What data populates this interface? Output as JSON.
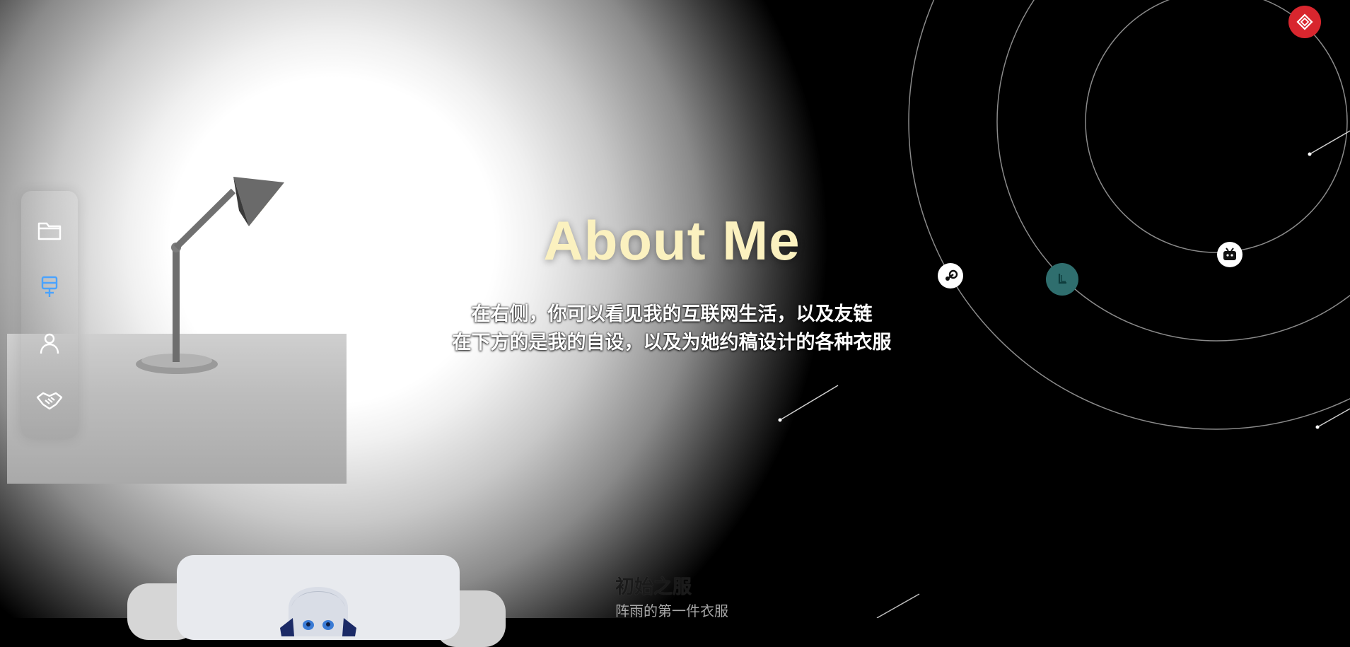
{
  "hero": {
    "title": "About Me",
    "line1": "在右侧，你可以看见我的互联网生活，以及友链",
    "line2": "在下方的是我的自设，以及为她约稿设计的各种衣服"
  },
  "side_nav": {
    "items": [
      {
        "name": "folder",
        "icon": "folder-icon",
        "active": false
      },
      {
        "name": "billboard",
        "icon": "billboard-icon",
        "active": true
      },
      {
        "name": "profile",
        "icon": "user-icon",
        "active": false
      },
      {
        "name": "friends",
        "icon": "handshake-icon",
        "active": false
      }
    ],
    "active_color": "#4aa3ff"
  },
  "orbit_links": [
    {
      "name": "steam",
      "icon": "steam-icon"
    },
    {
      "name": "anime-site",
      "icon": "anime-l-icon"
    },
    {
      "name": "bilibili",
      "icon": "bilibili-tv-icon"
    },
    {
      "name": "brand-logo",
      "icon": "diamond-logo-icon"
    }
  ],
  "outfit": {
    "title": "初始之服",
    "subtitle": "阵雨的第一件衣服"
  },
  "colors": {
    "title": "#fbf1bf",
    "brand_red": "#d8262e",
    "teal": "#2f6e6e"
  }
}
